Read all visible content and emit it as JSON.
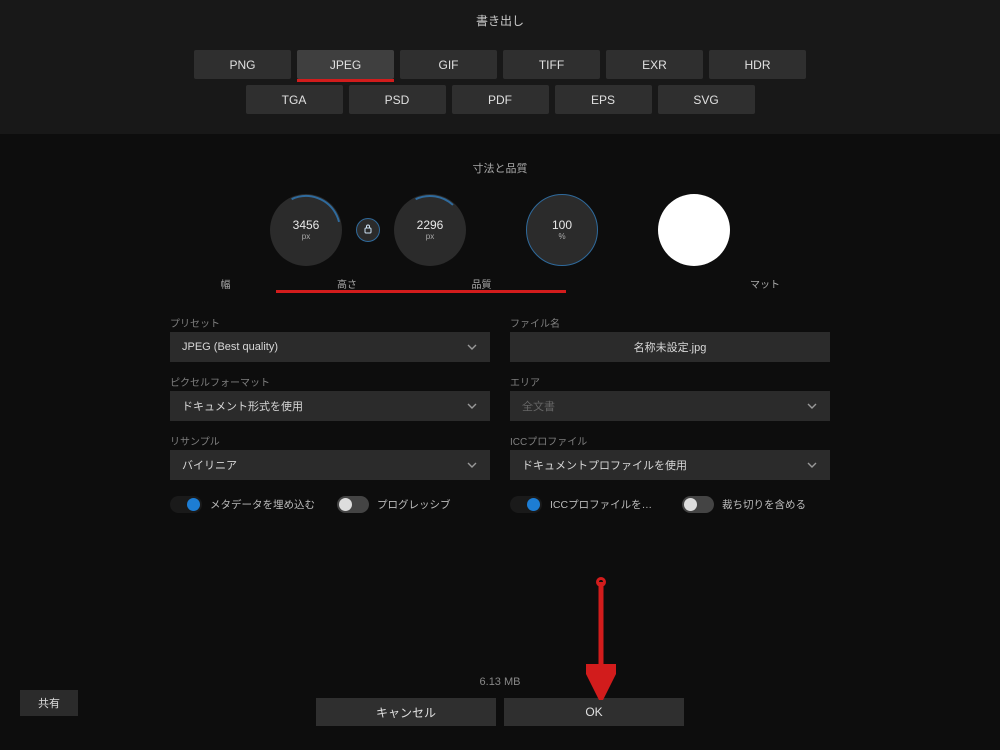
{
  "title": "書き出し",
  "formats": {
    "row1": [
      "PNG",
      "JPEG",
      "GIF",
      "TIFF",
      "EXR",
      "HDR"
    ],
    "row2": [
      "TGA",
      "PSD",
      "PDF",
      "EPS",
      "SVG"
    ],
    "selected": "JPEG"
  },
  "section_dimensions_label": "寸法と品質",
  "dials": {
    "width": {
      "value": "3456",
      "unit": "px",
      "label": "幅"
    },
    "height": {
      "value": "2296",
      "unit": "px",
      "label": "高さ"
    },
    "quality": {
      "value": "100",
      "unit": "%",
      "label": "品質"
    },
    "matte_label": "マット"
  },
  "lock_icon": "lock-icon",
  "fields": {
    "preset": {
      "label": "プリセット",
      "value": "JPEG (Best quality)"
    },
    "filename": {
      "label": "ファイル名",
      "value": "名称未設定.jpg"
    },
    "pixel_format": {
      "label": "ピクセルフォーマット",
      "value": "ドキュメント形式を使用"
    },
    "area": {
      "label": "エリア",
      "value": "全文書"
    },
    "resample": {
      "label": "リサンプル",
      "value": "バイリニア"
    },
    "icc_profile": {
      "label": "ICCプロファイル",
      "value": "ドキュメントプロファイルを使用"
    }
  },
  "toggles": {
    "embed_metadata": {
      "label": "メタデータを埋め込む",
      "on": true
    },
    "progressive": {
      "label": "プログレッシブ",
      "on": false
    },
    "embed_icc": {
      "label": "ICCプロファイルを埋…",
      "on": true
    },
    "include_bleed": {
      "label": "裁ち切りを含める",
      "on": false
    }
  },
  "filesize": "6.13 MB",
  "footer": {
    "cancel": "キャンセル",
    "ok": "OK"
  },
  "share": "共有",
  "colors": {
    "accent": "#1d7dd4",
    "annotation": "#d21c1c"
  }
}
